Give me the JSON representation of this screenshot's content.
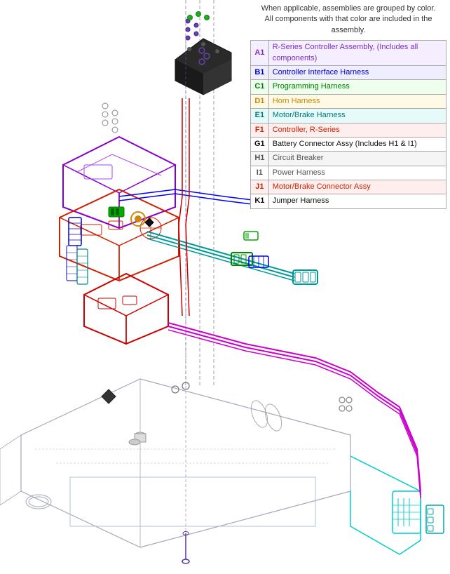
{
  "legend": {
    "header": "When applicable, assemblies are grouped by color. All components with that color are included in the assembly.",
    "rows": [
      {
        "code": "A1",
        "desc": "R-Series Controller Assembly, (Includes all components)",
        "color": "purple",
        "bg": "purple-light"
      },
      {
        "code": "B1",
        "desc": "Controller Interface Harness",
        "color": "blue",
        "bg": "blue-light"
      },
      {
        "code": "C1",
        "desc": "Programming Harness",
        "color": "green",
        "bg": "green-light"
      },
      {
        "code": "D1",
        "desc": "Horn Harness",
        "color": "gold",
        "bg": "gold-light"
      },
      {
        "code": "E1",
        "desc": "Motor/Brake Harness",
        "color": "teal",
        "bg": "teal-light"
      },
      {
        "code": "F1",
        "desc": "Controller, R-Series",
        "color": "red",
        "bg": "red-light"
      },
      {
        "code": "G1",
        "desc": "Battery Connector Assy (Includes H1 & I1)",
        "color": "black",
        "bg": "white"
      },
      {
        "code": "H1",
        "desc": "Circuit Breaker",
        "color": "gray",
        "bg": "gray-light"
      },
      {
        "code": "I1",
        "desc": "Power Harness",
        "color": "gray",
        "bg": "white"
      },
      {
        "code": "J1",
        "desc": "Motor/Brake Connector Assy",
        "color": "red",
        "bg": "red-light"
      },
      {
        "code": "K1",
        "desc": "Jumper Harness",
        "color": "black",
        "bg": "white"
      }
    ]
  },
  "diagram": {
    "alt": "Electrical assembly diagram showing wiring harnesses and components"
  }
}
